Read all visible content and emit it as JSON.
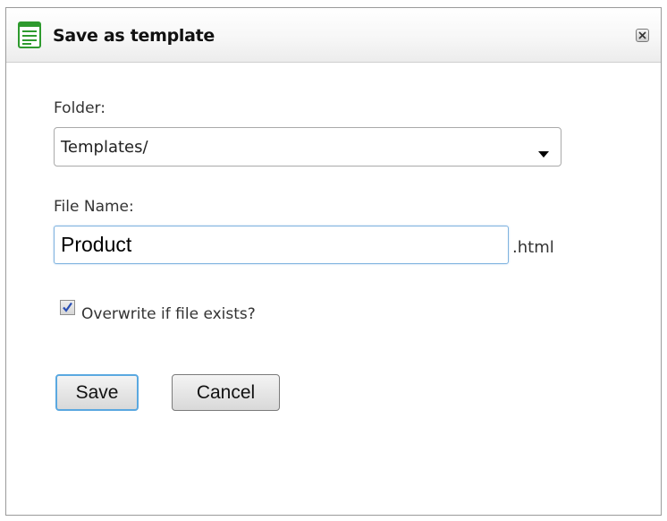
{
  "dialog": {
    "title": "Save as template",
    "icon": "document-lines-icon",
    "close_icon": "close-icon"
  },
  "folder": {
    "label": "Folder:",
    "selected": "Templates/"
  },
  "file_name": {
    "label": "File Name:",
    "value": "Product",
    "extension": ".html"
  },
  "overwrite": {
    "label": "Overwrite if file exists?",
    "checked": true
  },
  "buttons": {
    "save_label": "Save",
    "cancel_label": "Cancel"
  },
  "colors": {
    "icon_green": "#2e9a2e",
    "focus_blue": "#5aa8e0",
    "check_blue": "#2a4fb5"
  }
}
